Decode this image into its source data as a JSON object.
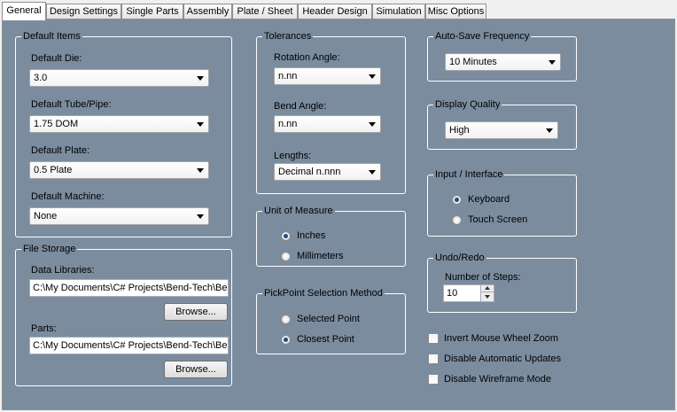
{
  "tabs": [
    "General",
    "Design Settings",
    "Single Parts",
    "Assembly",
    "Plate / Sheet",
    "Header Design",
    "Simulation",
    "Misc Options"
  ],
  "default_items": {
    "title": "Default Items",
    "die_label": "Default Die:",
    "die_value": "3.0",
    "tube_label": "Default Tube/Pipe:",
    "tube_value": "1.75 DOM",
    "plate_label": "Default Plate:",
    "plate_value": "0.5 Plate",
    "machine_label": "Default Machine:",
    "machine_value": "None"
  },
  "file_storage": {
    "title": "File Storage",
    "libraries_label": "Data Libraries:",
    "libraries_value": "C:\\My Documents\\C# Projects\\Bend-Tech\\Be",
    "parts_label": "Parts:",
    "parts_value": "C:\\My Documents\\C# Projects\\Bend-Tech\\Be",
    "browse_label": "Browse..."
  },
  "tolerances": {
    "title": "Tolerances",
    "rotation_label": "Rotation Angle:",
    "rotation_value": "n.nn",
    "bend_label": "Bend Angle:",
    "bend_value": "n.nn",
    "lengths_label": "Lengths:",
    "lengths_value": "Decimal n.nnn"
  },
  "unit_of_measure": {
    "title": "Unit of Measure",
    "options": [
      "Inches",
      "Millimeters"
    ],
    "selected": "Inches"
  },
  "pickpoint": {
    "title": "PickPoint Selection Method",
    "options": [
      "Selected Point",
      "Closest Point"
    ],
    "selected": "Closest Point"
  },
  "autosave": {
    "title": "Auto-Save Frequency",
    "value": "10 Minutes"
  },
  "display_quality": {
    "title": "Display Quality",
    "value": "High"
  },
  "input_interface": {
    "title": "Input / Interface",
    "options": [
      "Keyboard",
      "Touch Screen"
    ],
    "selected": "Keyboard"
  },
  "undo_redo": {
    "title": "Undo/Redo",
    "steps_label": "Number of Steps:",
    "steps_value": "10"
  },
  "checkboxes": [
    {
      "label": "Invert Mouse Wheel Zoom",
      "checked": false
    },
    {
      "label": "Disable Automatic Updates",
      "checked": false
    },
    {
      "label": "Disable Wireframe Mode",
      "checked": false
    }
  ]
}
